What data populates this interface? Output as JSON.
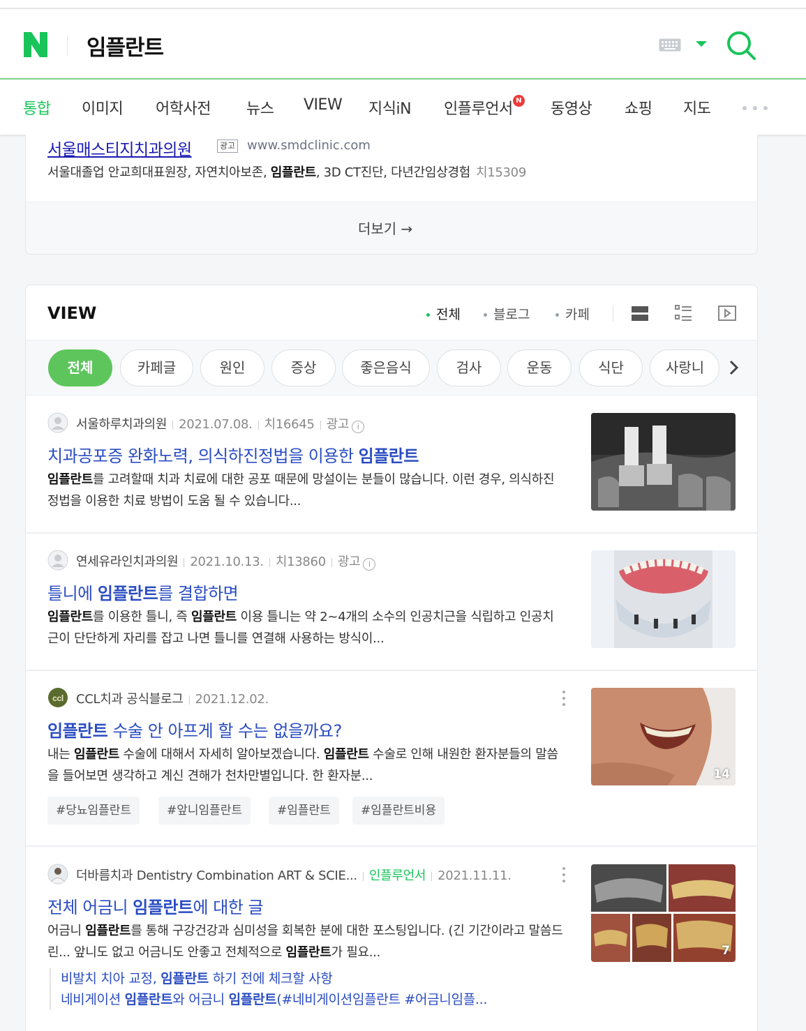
{
  "search": {
    "query": "임플란트",
    "logo_letter": "N"
  },
  "tabs": [
    {
      "label": "통합",
      "active": true
    },
    {
      "label": "이미지"
    },
    {
      "label": "어학사전"
    },
    {
      "label": "뉴스"
    },
    {
      "label": "VIEW"
    },
    {
      "label": "지식iN"
    },
    {
      "label": "인플루언서",
      "badge": "N"
    },
    {
      "label": "동영상"
    },
    {
      "label": "쇼핑"
    },
    {
      "label": "지도"
    }
  ],
  "ad": {
    "title": "서울매스티지치과의원",
    "badge": "광고",
    "url": "www.smdclinic.com",
    "desc_pre": "서울대졸업 안교희대표원장, 자연치아보존, ",
    "desc_bold": "임플란트",
    "desc_post": ", 3D CT진단, 다년간임상경험",
    "count": "치15309",
    "more_label": "더보기 →"
  },
  "view": {
    "title": "VIEW",
    "filters": [
      {
        "label": "전체",
        "active": true
      },
      {
        "label": "블로그"
      },
      {
        "label": "카페"
      }
    ],
    "chips": [
      "전체",
      "카페글",
      "원인",
      "증상",
      "좋은음식",
      "검사",
      "운동",
      "식단",
      "사랑니"
    ],
    "posts": [
      {
        "author": "서울하루치과의원",
        "date": "2021.07.08.",
        "count": "치16645",
        "ad_label": "광고",
        "title_pre": "치과공포증 완화노력, 의식하진정법을 이용한 ",
        "title_bold": "임플란트",
        "body_bold1": "임플란트",
        "body_rest": "를 고려할때 치과 치료에 대한 공포 때문에 망설이는 분들이 많습니다. 이런 경우, 의식하진정법을 이용한 치료 방법이 도움 될 수 있습니다..."
      },
      {
        "author": "연세유라인치과의원",
        "date": "2021.10.13.",
        "count": "치13860",
        "ad_label": "광고",
        "title_pre": "틀니에 ",
        "title_bold": "임플란트",
        "title_post": "를 결합하면",
        "body_bold1": "임플란트",
        "body_mid": "를 이용한 틀니, 즉 ",
        "body_bold2": "임플란트",
        "body_rest": " 이용 틀니는 약 2~4개의 소수의 인공치근을 식립하고 인공치근이 단단하게 자리를 잡고 나면 틀니를 연결해 사용하는 방식이..."
      },
      {
        "author": "CCL치과 공식블로그",
        "date": "2021.12.02.",
        "title_bold": "임플란트",
        "title_post": " 수술 안 아프게 할 수는 없을까요?",
        "body_pre": "내는 ",
        "body_bold1": "임플란트",
        "body_mid": " 수술에 대해서 자세히 알아보겠습니다. ",
        "body_bold2": "임플란트",
        "body_rest": " 수술로 인해 내원한 환자분들의 말씀을 들어보면 생각하고 계신 견해가 천차만별입니다. 한 환자분...",
        "thumb_count": "14",
        "tags": [
          "#당뇨임플란트",
          "#앞니임플란트",
          "#임플란트",
          "#임플란트비용"
        ]
      },
      {
        "author": "더바름치과 Dentistry Combination ART & SCIE...",
        "influencer": "인플루언서",
        "date": "2021.11.11.",
        "title_pre": "전체 어금니 ",
        "title_bold": "임플란트",
        "title_post": "에 대한 글",
        "body_pre": "어금니 ",
        "body_bold1": "임플란트",
        "body_mid": "를 통해 구강건강과 심미성을 회복한 분에 대한 포스팅입니다. (긴 기간이라고 말씀드린... 앞니도 없고 어금니도 안좋고 전체적으로 ",
        "body_bold2": "임플란트",
        "body_rest": "가 필요...",
        "thumb_count": "7",
        "sub1_pre": "비발치 치아 교정, ",
        "sub1_bold": "임플란트",
        "sub1_post": " 하기 전에 체크할 사항",
        "sub2_pre": "네비게이션 ",
        "sub2_bold1": "임플란트",
        "sub2_mid": "와 어금니 ",
        "sub2_bold2": "임플란트",
        "sub2_post": "(#네비게이션임플란트 #어금니임플..."
      }
    ]
  },
  "colors": {
    "naver_green": "#19c45a",
    "link_blue": "#2a4cc2",
    "chip_active": "#5ec55d"
  }
}
